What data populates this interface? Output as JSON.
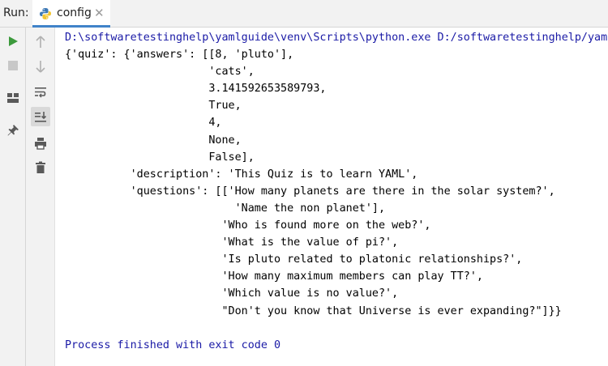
{
  "header": {
    "run_label": "Run:",
    "tab_label": "config",
    "tab_close": "✕"
  },
  "toolbar": {
    "left_icons": [
      "play-icon",
      "stop-icon",
      "layout-icon",
      "pin-icon"
    ],
    "mid_icons": [
      "up-arrow-icon",
      "down-arrow-icon",
      "soft-wrap-icon",
      "scroll-to-end-icon",
      "print-icon",
      "trash-icon"
    ]
  },
  "console": {
    "command": "D:\\softwaretestinghelp\\yamlguide\\venv\\Scripts\\python.exe D:/softwaretestinghelp/yamlgu",
    "output": [
      "{'quiz': {'answers': [[8, 'pluto'],",
      "                      'cats',",
      "                      3.141592653589793,",
      "                      True,",
      "                      4,",
      "                      None,",
      "                      False],",
      "          'description': 'This Quiz is to learn YAML',",
      "          'questions': [['How many planets are there in the solar system?',",
      "                          'Name the non planet'],",
      "                        'Who is found more on the web?',",
      "                        'What is the value of pi?',",
      "                        'Is pluto related to platonic relationships?',",
      "                        'How many maximum members can play TT?',",
      "                        'Which value is no value?',",
      "                        \"Don't you know that Universe is ever expanding?\"]}}",
      ""
    ],
    "exit_message": "Process finished with exit code 0"
  },
  "colors": {
    "play": "#3c9a3c",
    "stop": "#c8c8c8",
    "accent": "#4083c9",
    "console_link": "#1a1aa6"
  }
}
